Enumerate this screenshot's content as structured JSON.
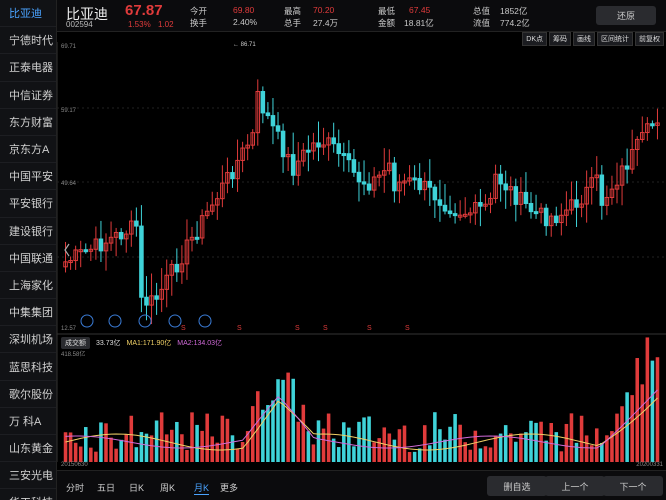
{
  "sidebar": {
    "items": [
      {
        "label": "比亚迪",
        "active": true
      },
      {
        "label": "宁德时代"
      },
      {
        "label": "正泰电器"
      },
      {
        "label": "中信证券"
      },
      {
        "label": "东方财富"
      },
      {
        "label": "京东方A"
      },
      {
        "label": "中国平安"
      },
      {
        "label": "平安银行"
      },
      {
        "label": "建设银行"
      },
      {
        "label": "中国联通"
      },
      {
        "label": "上海家化"
      },
      {
        "label": "中集集团"
      },
      {
        "label": "深圳机场"
      },
      {
        "label": "蓝思科技"
      },
      {
        "label": "歌尔股份"
      },
      {
        "label": "万 科A"
      },
      {
        "label": "山东黄金"
      },
      {
        "label": "三安光电"
      },
      {
        "label": "华工科技"
      }
    ]
  },
  "header": {
    "name": "比亚迪",
    "code": "002594",
    "price": "67.87",
    "pct": "1.53%",
    "chg": "1.02",
    "open_label": "今开",
    "open_val": "69.80",
    "turnover_label": "换手",
    "turnover_val": "2.40%",
    "high_label": "最高",
    "high_val": "70.20",
    "volume_label": "总手",
    "volume_val": "27.4万",
    "low_label": "最低",
    "low_val": "67.45",
    "amount_label": "金额",
    "amount_val": "18.81亿",
    "total_cap_label": "总值",
    "total_cap_val": "1852亿",
    "float_cap_label": "流值",
    "float_cap_val": "774.2亿",
    "follow_btn": "还原"
  },
  "toolbar": {
    "buttons": [
      "DK点",
      "筹码",
      "画线",
      "区间统计",
      "前复权"
    ]
  },
  "chart": {
    "price_ticks": [
      "69.71",
      "59.17",
      "49.64",
      "12.57"
    ],
    "high_marker": "86.71",
    "volume_button": "成交额",
    "volume_value": "33.73亿",
    "ma1_label": "MA1:171.90亿",
    "ma2_label": "MA2:134.03亿",
    "vol_max": "418.58亿",
    "date_start": "20150630",
    "date_end": "20200331",
    "colors": {
      "up": "#e03b3b",
      "down": "#3fd3d9",
      "ma1": "#f0d066",
      "ma2": "#d06ad8",
      "accent": "#4aa3ff"
    },
    "s_markers": [
      "S",
      "S",
      "S",
      "S",
      "S",
      "S"
    ]
  },
  "bottom": {
    "periods": [
      "分时",
      "五日",
      "日K",
      "周K",
      "月K",
      "更多"
    ],
    "active_period": 4,
    "add_watch": "删自选",
    "prev": "上一个",
    "next": "下一个"
  }
}
